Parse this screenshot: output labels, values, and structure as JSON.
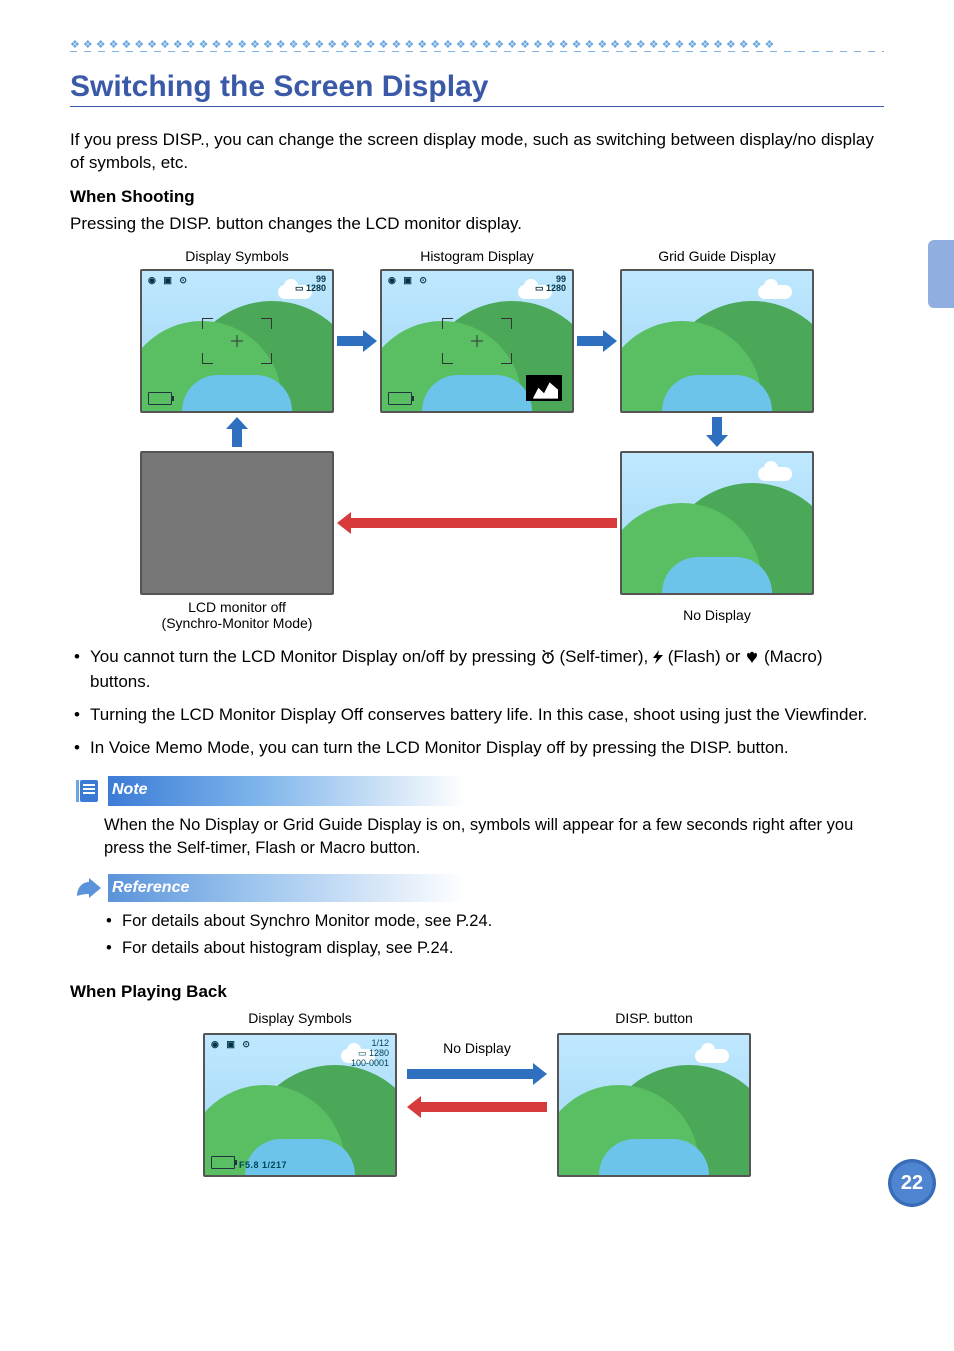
{
  "page_number": "22",
  "title": "Switching the Screen Display",
  "intro": "If you press DISP., you can change the screen display mode, such as switching between display/no display of symbols, etc.",
  "section_shoot": {
    "heading": "When Shooting",
    "lead": "Pressing the DISP. button changes the LCD monitor display.",
    "captions": {
      "symbols": "Display Symbols",
      "histogram": "Histogram Display",
      "grid": "Grid Guide Display",
      "off_line1": "LCD monitor off",
      "off_line2": "(Synchro-Monitor Mode)",
      "nodisplay": "No Display"
    },
    "osd": {
      "top_right_1": "99",
      "top_right_2": "1280"
    }
  },
  "bullets": [
    {
      "pre": "You cannot turn the LCD Monitor Display on/off by pressing ",
      "mid1": " (Self-timer), ",
      "mid2": " (Flash) or ",
      "post": " (Macro) buttons."
    },
    {
      "text": "Turning the LCD Monitor Display Off conserves battery life. In this case, shoot using just the Viewfinder."
    },
    {
      "text": "In Voice Memo Mode, you can turn the LCD Monitor Display off by pressing the DISP. button."
    }
  ],
  "note": {
    "label": "Note",
    "text": "When the No Display or Grid Guide Display is on, symbols will appear for a few seconds right after you press the Self-timer, Flash or Macro button."
  },
  "reference": {
    "label": "Reference",
    "items": [
      {
        "text": "For details about Synchro Monitor mode, see ",
        "xref": "P.24",
        "tail": "."
      },
      {
        "text": "For details about histogram display, see ",
        "xref": "P.24",
        "tail": "."
      }
    ]
  },
  "section_play": {
    "heading": "When Playing Back",
    "captions": {
      "symbols": "Display Symbols",
      "nodisplay": "No Display",
      "disp": "DISP. button"
    },
    "osd": {
      "l1": "1/12",
      "l2": "1280",
      "l3": "100-0001",
      "foot": "F5.8 1/217"
    }
  }
}
